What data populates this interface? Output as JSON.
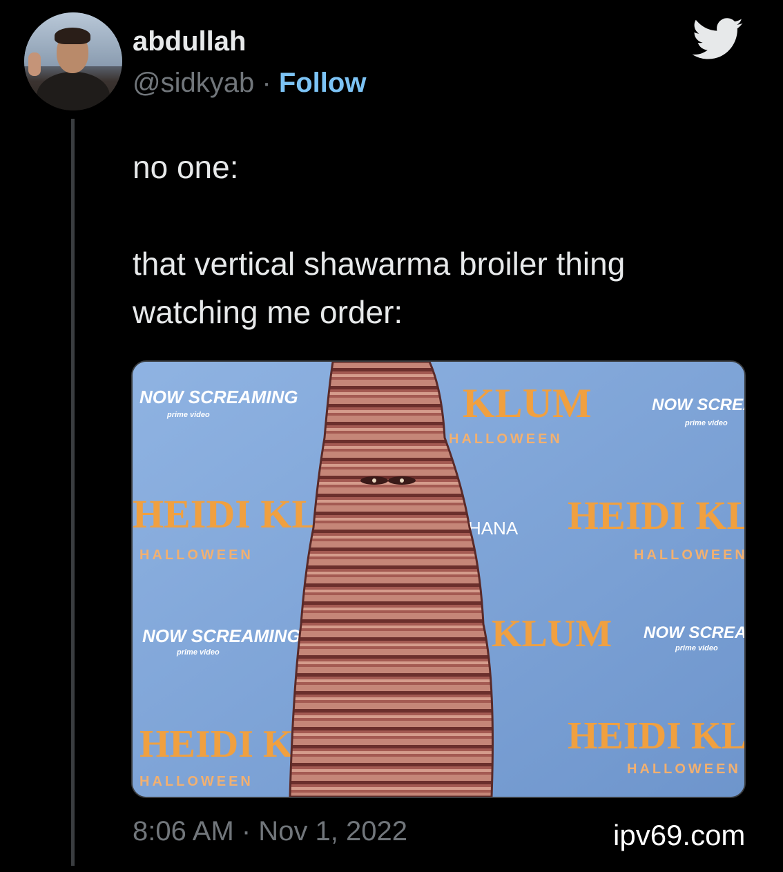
{
  "author": {
    "display_name": "abdullah",
    "handle": "@sidkyab",
    "separator": "·",
    "follow_label": "Follow"
  },
  "tweet": {
    "line1": "no one:",
    "line2": "that vertical shawarma broiler thing watching me order:"
  },
  "media": {
    "backdrop_texts": {
      "now_screaming": "NOW SCREAMING",
      "prime_video": "prime video",
      "klum": "KLUM",
      "heidi_klum": "HEIDI KLUM",
      "halloween": "HALLOWEEN",
      "hana": "HANA"
    }
  },
  "meta": {
    "timestamp": "8:06 AM · Nov 1, 2022"
  },
  "watermark": "ipv69.com",
  "colors": {
    "background": "#000000",
    "text": "#e7e9ea",
    "muted": "#71767b",
    "link": "#7cc3f5",
    "backdrop": "#7da3d6",
    "brand_orange": "#f0a040"
  },
  "icons": [
    "twitter-bird-icon"
  ]
}
